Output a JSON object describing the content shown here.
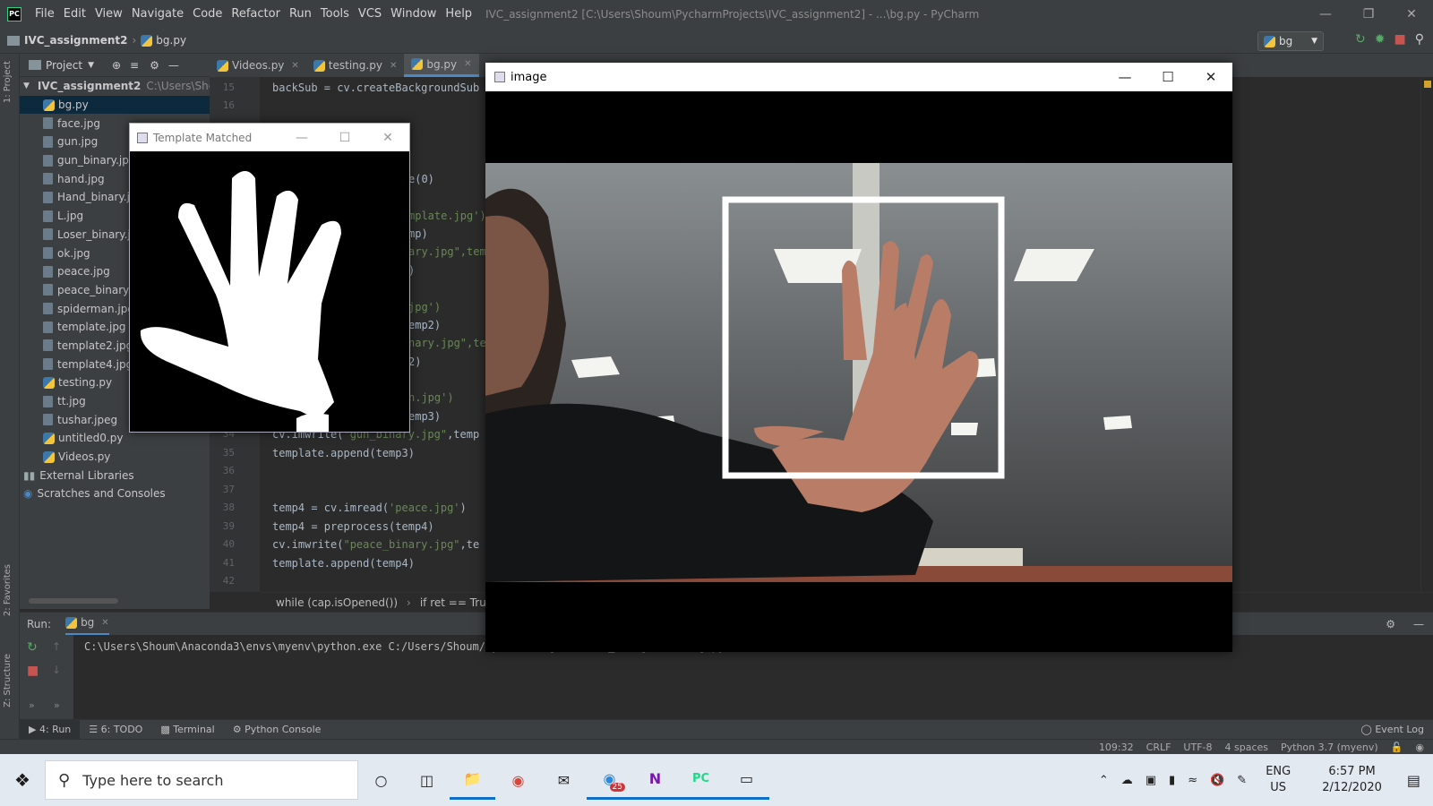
{
  "titlebar": {
    "menu": [
      "File",
      "Edit",
      "View",
      "Navigate",
      "Code",
      "Refactor",
      "Run",
      "Tools",
      "VCS",
      "Window",
      "Help"
    ],
    "window_title": "IVC_assignment2 [C:\\Users\\Shoum\\PycharmProjects\\IVC_assignment2] - ...\\bg.py - PyCharm"
  },
  "navbar": {
    "project": "IVC_assignment2",
    "file": "bg.py",
    "run_config": "bg"
  },
  "project_panel": {
    "title": "Project",
    "root": "IVC_assignment2",
    "root_path": "C:\\Users\\Shoum",
    "files": [
      "bg.py",
      "face.jpg",
      "gun.jpg",
      "gun_binary.jpg",
      "hand.jpg",
      "Hand_binary.jp",
      "L.jpg",
      "Loser_binary.jp",
      "ok.jpg",
      "peace.jpg",
      "peace_binary.j",
      "spiderman.jpg",
      "template.jpg",
      "template2.jpg",
      "template4.jpg",
      "testing.py",
      "tt.jpg",
      "tushar.jpeg",
      "untitled0.py",
      "Videos.py"
    ],
    "external": "External Libraries",
    "scratches": "Scratches and Consoles"
  },
  "side_labels": {
    "project": "1: Project",
    "favorites": "2: Favorites",
    "structure": "Z: Structure"
  },
  "tabs": [
    "Videos.py",
    "testing.py",
    "bg.py"
  ],
  "editor": {
    "line_numbers": [
      "15",
      "16",
      "34",
      "35",
      "36",
      "37",
      "38",
      "39",
      "40",
      "41",
      "42"
    ],
    "line15": "backSub = cv.createBackgroundSub",
    "partials": [
      "e(0)",
      "mplate.jpg')",
      "mp)",
      "ary.jpg\",tem",
      ")",
      "jpg')",
      "emp2)",
      "nary.jpg\",te",
      "2)",
      "n.jpg')",
      "emp3)"
    ],
    "line34a": "cv.imwrite(",
    "line34b": "\"gun_binary.jpg\"",
    "line34c": ",temp",
    "line35": "template.append(temp3)",
    "line38a": "temp4 = cv.imread(",
    "line38b": "'peace.jpg'",
    "line38c": ")",
    "line39": "temp4 = preprocess(temp4)",
    "line40a": "cv.imwrite(",
    "line40b": "\"peace_binary.jpg\"",
    "line40c": ",te",
    "line41": "template.append(temp4)"
  },
  "code_breadcrumb": [
    "while (cap.isOpened())",
    "if ret == True"
  ],
  "run_panel": {
    "label": "Run:",
    "tab": "bg",
    "output": "C:\\Users\\Shoum\\Anaconda3\\envs\\myenv\\python.exe C:/Users/Shoum/PycharmProjects/IVC_assignment2/bg.py"
  },
  "tool_windows": [
    "4: Run",
    "6: TODO",
    "Terminal",
    "Python Console"
  ],
  "event_log": "Event Log",
  "status": {
    "position": "109:32",
    "line_sep": "CRLF",
    "encoding": "UTF-8",
    "indent": "4 spaces",
    "interpreter": "Python 3.7 (myenv)"
  },
  "image_window": {
    "title": "image"
  },
  "template_window": {
    "title": "Template Matched"
  },
  "taskbar": {
    "search_placeholder": "Type here to search",
    "badge": "25",
    "lang1": "ENG",
    "lang2": "US",
    "time": "6:57 PM",
    "date": "2/12/2020"
  },
  "colors": {
    "ide_bg": "#2b2b2b",
    "panel": "#3c3f41",
    "accent": "#4a88c7",
    "string": "#6a8759"
  }
}
